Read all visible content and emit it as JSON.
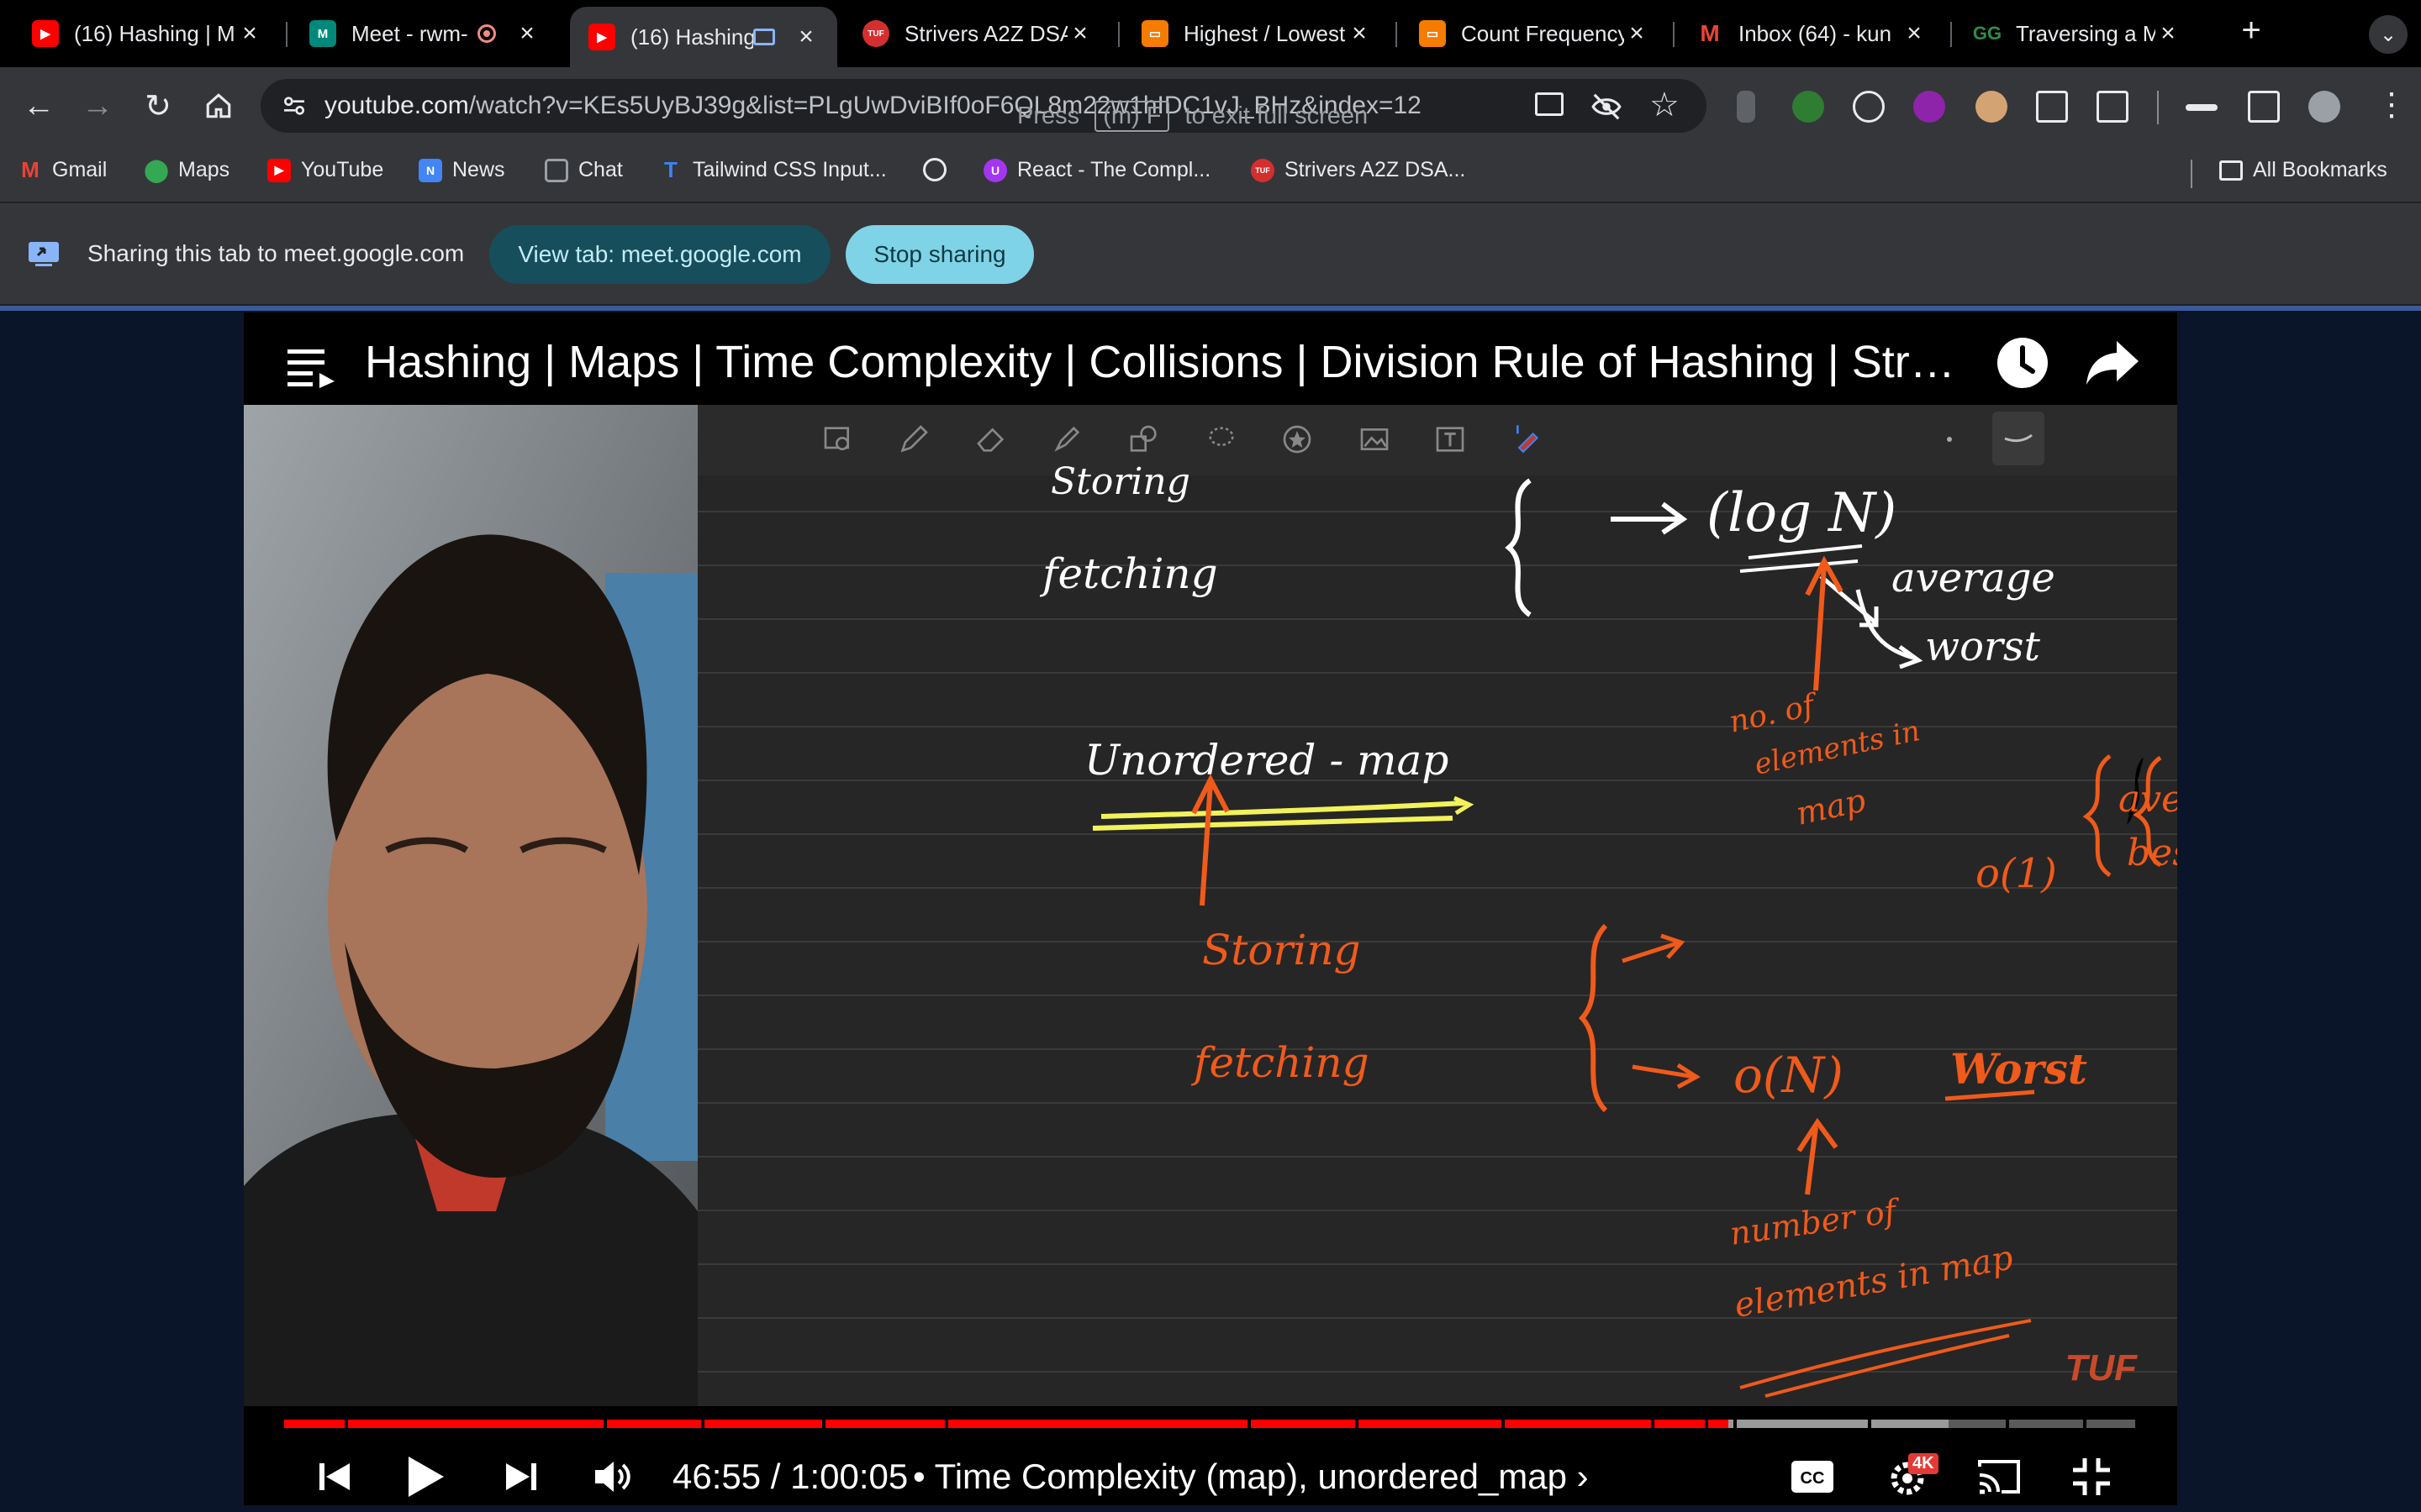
{
  "tabs": [
    {
      "title": "(16) Hashing | M",
      "favicon": "youtube-icon",
      "active": false
    },
    {
      "title": "Meet - rwm-",
      "favicon": "meet-icon",
      "active": false
    },
    {
      "title": "(16) Hashing",
      "favicon": "youtube-icon",
      "active": true
    },
    {
      "title": "Strivers A2Z DSA",
      "favicon": "tuf-icon",
      "active": false
    },
    {
      "title": "Highest / Lowest",
      "favicon": "codingninjas-icon",
      "active": false
    },
    {
      "title": "Count Frequency",
      "favicon": "codingninjas-icon",
      "active": false
    },
    {
      "title": "Inbox (64) - kun",
      "favicon": "gmail-icon",
      "active": false
    },
    {
      "title": "Traversing a Map",
      "favicon": "gfg-icon",
      "active": false
    }
  ],
  "toolbar": {
    "url_host": "youtube.com",
    "url_path": "/watch?v=KEs5UyBJ39g&list=PLgUwDviBIf0oF6QL8m22w1hIDC1vJ_BHz&index=12",
    "fullscreen_hint_prefix": "Press",
    "fullscreen_hint_key": "(m) F",
    "fullscreen_hint_suffix": "to exit full screen"
  },
  "bookmarks": {
    "items": [
      {
        "label": "Gmail",
        "icon": "gmail-icon",
        "color": "#ea4335"
      },
      {
        "label": "Maps",
        "icon": "maps-icon",
        "color": "#34a853"
      },
      {
        "label": "YouTube",
        "icon": "youtube-icon",
        "color": "#ff0000"
      },
      {
        "label": "News",
        "icon": "news-icon",
        "color": "#4285f4"
      },
      {
        "label": "Chat",
        "icon": "chat-icon",
        "color": "#9aa0a6"
      },
      {
        "label": "Tailwind CSS Input...",
        "icon": "tailwind-icon",
        "color": "#3b82f6"
      },
      {
        "label": "",
        "icon": "globe-icon",
        "color": "#e8eaed"
      },
      {
        "label": "React - The Compl...",
        "icon": "udemy-icon",
        "color": "#a435f0"
      },
      {
        "label": "Strivers A2Z DSA...",
        "icon": "tuf-icon",
        "color": "#d32f2f"
      }
    ],
    "all_bookmarks": "All Bookmarks"
  },
  "sharing": {
    "message": "Sharing this tab to meet.google.com",
    "view_tab": "View tab: meet.google.com",
    "stop": "Stop sharing"
  },
  "video": {
    "title": "Hashing | Maps | Time Complexity | Collisions | Division Rule of Hashing | Striv...",
    "current_time": "46:55",
    "separator": " / ",
    "duration": "1:00:05",
    "chapter": "• Time Complexity (map), unordered_map ›",
    "watched_fraction": 0.78,
    "quality_badge": "4K",
    "watermark": "TUF"
  },
  "notes": {
    "top": {
      "storing": "Storing",
      "fetching": "fetching",
      "logn": "(log N)",
      "average": "average",
      "worst": "worst",
      "no_of": "no. of",
      "elements_in": "elements in",
      "map": "map"
    },
    "bottom": {
      "unordered_map": "Unordered - map",
      "o1": "o(1)",
      "average": "average",
      "best": "best",
      "storing": "Storing",
      "fetching": "fetching",
      "on": "o(N)",
      "worst": "Worst",
      "number_of": "number of",
      "elements_in_map": "elements in map"
    }
  },
  "colors": {
    "tab_bar": "#000000",
    "toolbar": "#35363a",
    "board": "#262626",
    "ink_white": "#ffffff",
    "ink_orange": "#f05a1a",
    "ink_yellow": "#f2f25a",
    "progress_red": "#ff0000",
    "share_teal": "#174e5c",
    "share_cyan": "#7fd3e6"
  }
}
